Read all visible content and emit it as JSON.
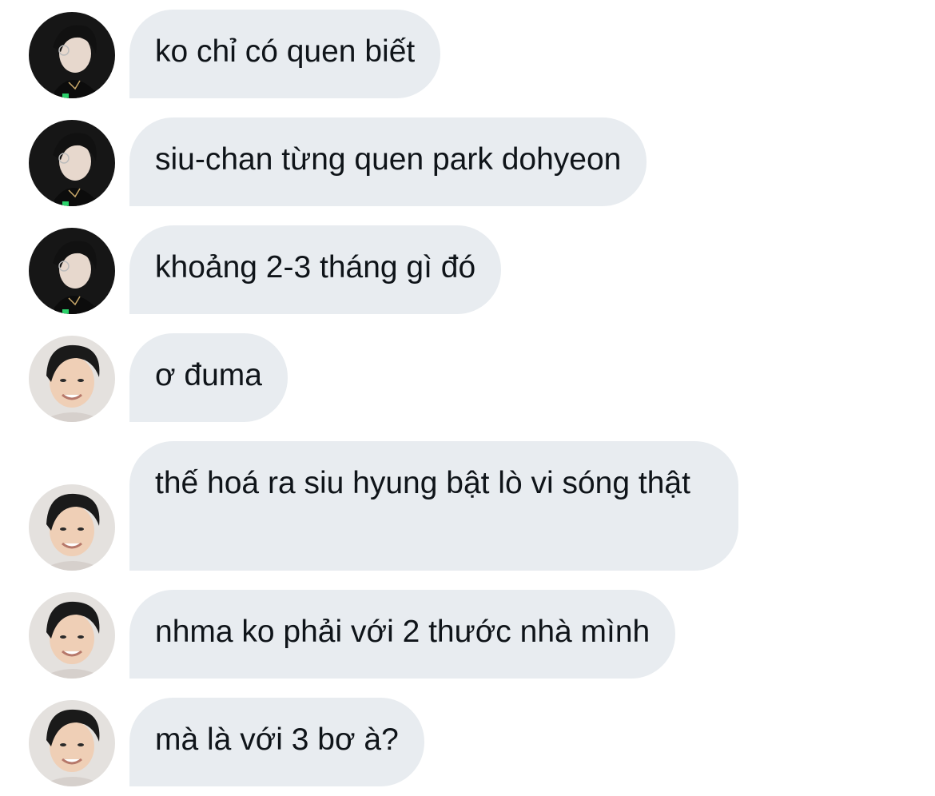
{
  "conversation": {
    "messages": [
      {
        "sender": "siu",
        "text": "ko chỉ có quen biết"
      },
      {
        "sender": "siu",
        "text": "siu-chan từng quen park dohyeon"
      },
      {
        "sender": "siu",
        "text": "khoảng 2-3 tháng gì đó"
      },
      {
        "sender": "other",
        "text": "ơ đuma"
      },
      {
        "sender": "other",
        "text": "thế hoá ra siu hyung bật lò vi sóng thật"
      },
      {
        "sender": "other",
        "text": "nhma ko phải với 2 thước nhà mình"
      },
      {
        "sender": "other",
        "text": "mà là với 3 bơ à?"
      }
    ]
  },
  "colors": {
    "bubble_bg": "#e8ecf0",
    "text": "#0f1419",
    "background": "#ffffff"
  }
}
